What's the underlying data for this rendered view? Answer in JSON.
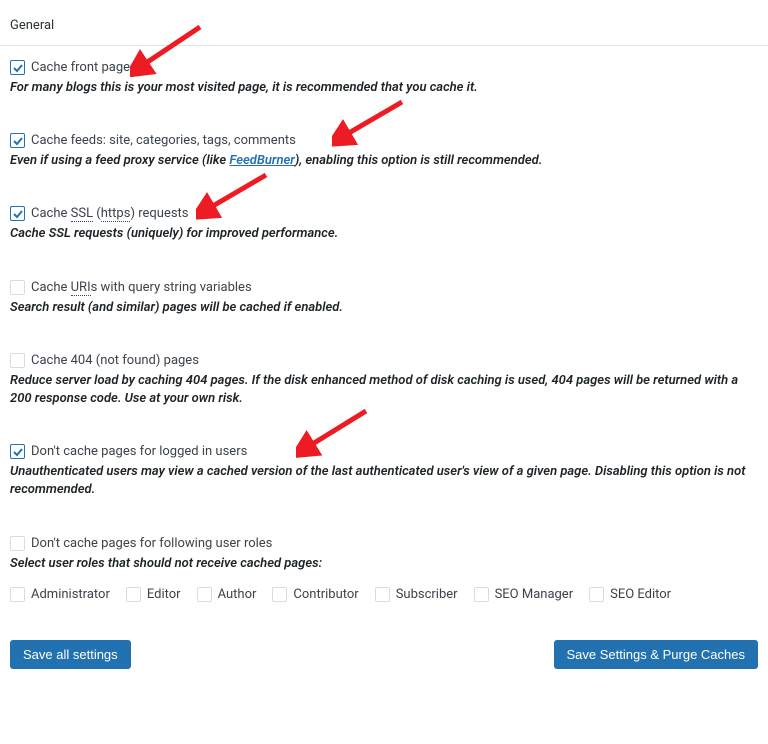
{
  "header": {
    "title": "General"
  },
  "options": {
    "front_page": {
      "label": "Cache front page",
      "checked": true,
      "description": "For many blogs this is your most visited page, it is recommended that you cache it."
    },
    "feeds": {
      "label": "Cache feeds: site, categories, tags, comments",
      "checked": true,
      "description_before": "Even if using a feed proxy service (like ",
      "link_text": "FeedBurner",
      "description_after": "), enabling this option is still recommended."
    },
    "ssl": {
      "label_before": "Cache ",
      "ssl_text": "SSL",
      "https_text": "https",
      "label_after": " requests",
      "checked": true,
      "description": "Cache SSL requests (uniquely) for improved performance."
    },
    "query_string": {
      "label_before": "Cache ",
      "uri_text": "URI",
      "label_after": "s with query string variables",
      "checked": false,
      "description": "Search result (and similar) pages will be cached if enabled."
    },
    "404": {
      "label": "Cache 404 (not found) pages",
      "checked": false,
      "description": "Reduce server load by caching 404 pages. If the disk enhanced method of disk caching is used, 404 pages will be returned with a 200 response code. Use at your own risk."
    },
    "logged_in": {
      "label": "Don't cache pages for logged in users",
      "checked": true,
      "description": "Unauthenticated users may view a cached version of the last authenticated user's view of a given page. Disabling this option is not recommended."
    },
    "user_roles": {
      "label": "Don't cache pages for following user roles",
      "checked": false,
      "description": "Select user roles that should not receive cached pages:"
    }
  },
  "roles": [
    "Administrator",
    "Editor",
    "Author",
    "Contributor",
    "Subscriber",
    "SEO Manager",
    "SEO Editor"
  ],
  "buttons": {
    "save_all": "Save all settings",
    "save_purge": "Save Settings & Purge Caches"
  },
  "colors": {
    "accent": "#2271b1",
    "arrow": "#ed1c24"
  }
}
